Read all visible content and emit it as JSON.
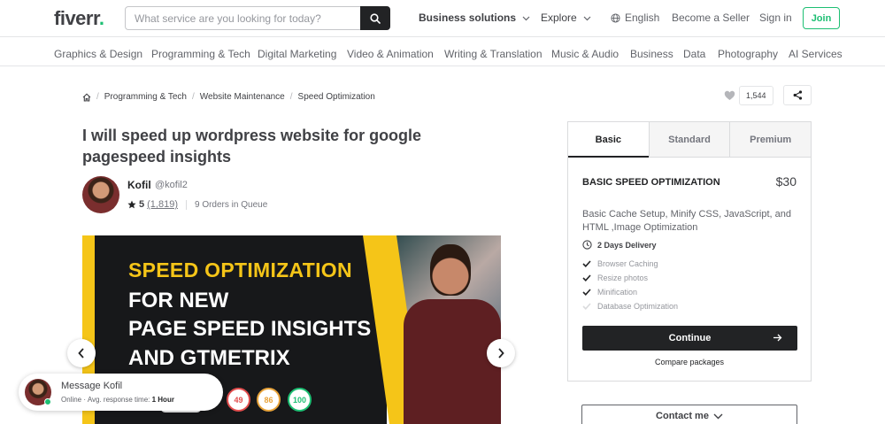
{
  "header": {
    "logo_text": "fiverr",
    "logo_dot": ".",
    "search_placeholder": "What service are you looking for today?",
    "business_solutions": "Business solutions",
    "explore": "Explore",
    "language": "English",
    "become_seller": "Become a Seller",
    "sign_in": "Sign in",
    "join": "Join"
  },
  "categories": [
    "Graphics & Design",
    "Programming & Tech",
    "Digital Marketing",
    "Video & Animation",
    "Writing & Translation",
    "Music & Audio",
    "Business",
    "Data",
    "Photography",
    "AI Services"
  ],
  "breadcrumb": [
    "Programming & Tech",
    "Website Maintenance",
    "Speed Optimization"
  ],
  "likes": "1,544",
  "gig": {
    "title": "I will speed up wordpress website for google pagespeed insights",
    "seller_name": "Kofil",
    "seller_handle": "@kofil2",
    "rating": "5",
    "reviews": "(1,819)",
    "queue": "9 Orders in Queue"
  },
  "gig_image": {
    "line1": "SPEED OPTIMIZATION",
    "line2": "FOR NEW",
    "line3": "PAGE SPEED INSIGHTS",
    "line4": "AND GTMETRIX",
    "scores": [
      "49",
      "86",
      "100"
    ]
  },
  "message": {
    "title": "Message Kofil",
    "status": "Online",
    "response_label": "Avg. response time:",
    "response_value": "1 Hour"
  },
  "package": {
    "tabs": [
      "Basic",
      "Standard",
      "Premium"
    ],
    "name": "BASIC SPEED OPTIMIZATION",
    "price": "$30",
    "description": "Basic Cache Setup, Minify CSS, JavaScript, and HTML ,Image Optimization",
    "delivery": "2 Days Delivery",
    "features": [
      {
        "label": "Browser Caching",
        "included": true
      },
      {
        "label": "Resize photos",
        "included": true
      },
      {
        "label": "Minification",
        "included": true
      },
      {
        "label": "Database Optimization",
        "included": false
      }
    ],
    "continue": "Continue",
    "compare": "Compare packages",
    "contact": "Contact me"
  },
  "colors": {
    "brand": "#1dbf73",
    "dark": "#222325",
    "score_red": "#e24d4d",
    "score_orange": "#e8a33a",
    "score_green": "#1dbf73"
  }
}
